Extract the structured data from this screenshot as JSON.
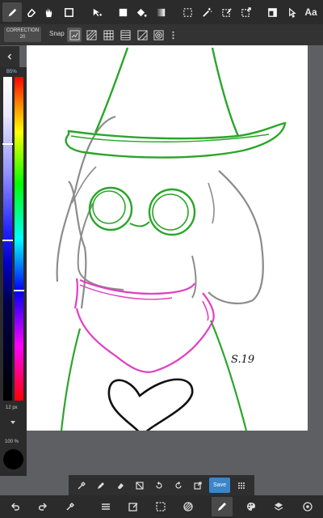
{
  "top_toolbar": {
    "text_tool_label": "Aa"
  },
  "sub_toolbar": {
    "correction_label": "CORRECTION",
    "correction_value": "20",
    "snap_label": "Snap"
  },
  "color_panel": {
    "hex_label": "B5%",
    "brush_size": "12 px",
    "opacity": "100 %",
    "current_color": "#000000"
  },
  "tool_strip": {
    "save_label": "Save"
  },
  "canvas": {
    "signature": "S.19"
  },
  "colors": {
    "toolbar_bg": "#2b2b2b",
    "workspace_bg": "#5d5f63",
    "canvas_bg": "#ffffff",
    "accent_blue": "#3a86c8",
    "line_green": "#2aa52a",
    "line_pink": "#e040c0",
    "line_grey": "#8c8c8c"
  }
}
